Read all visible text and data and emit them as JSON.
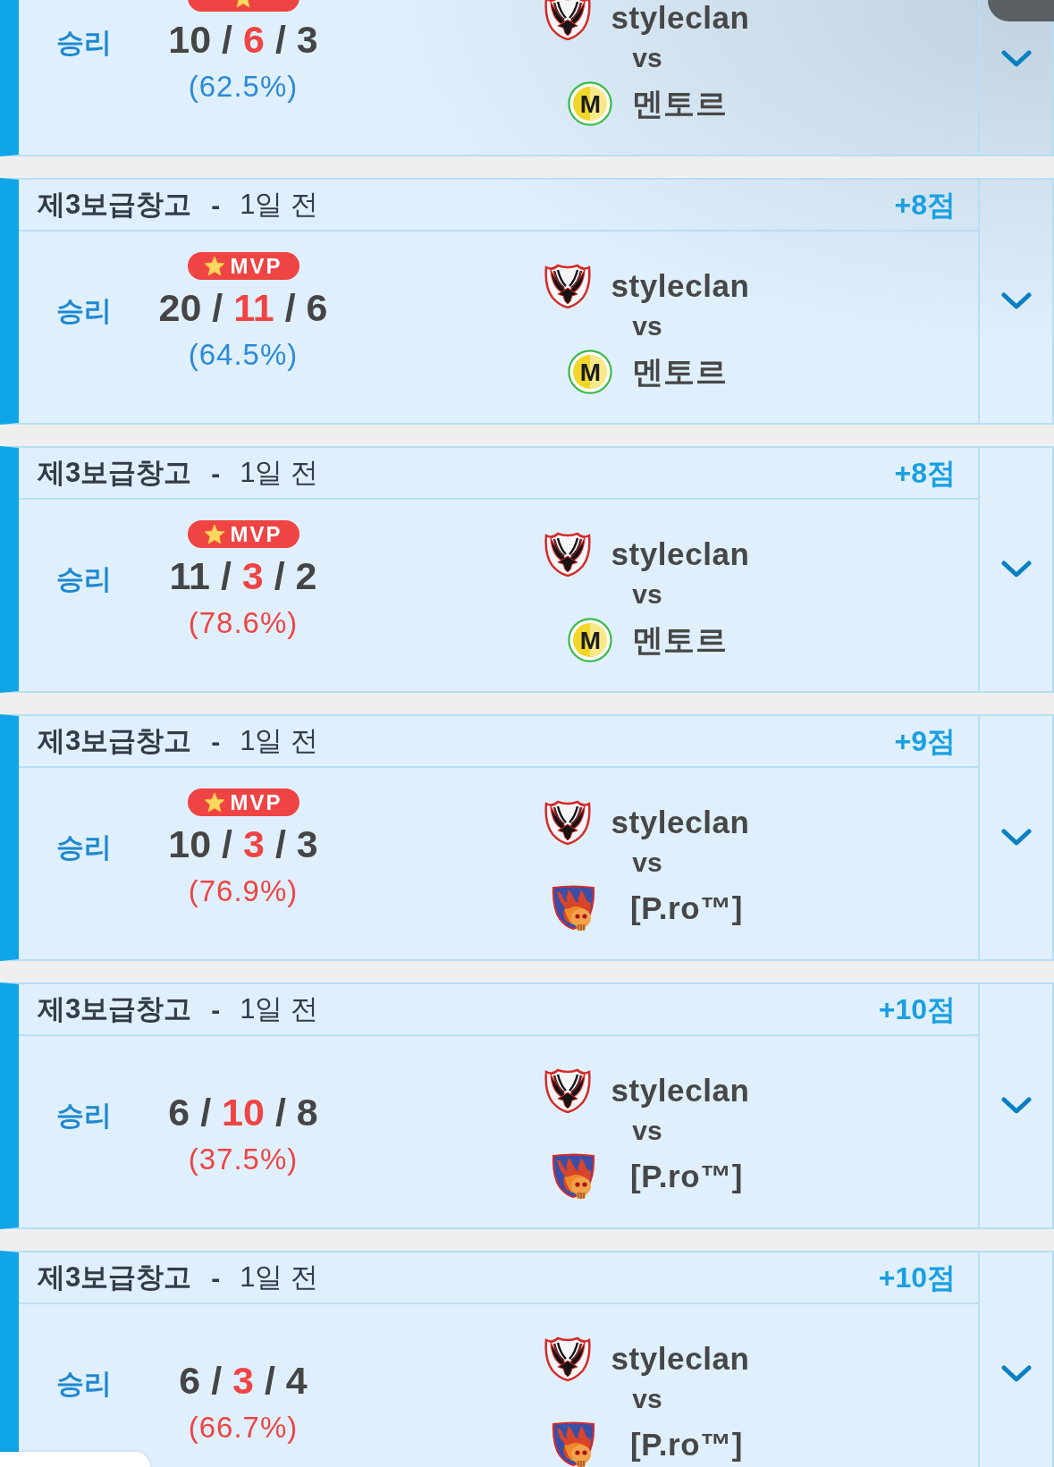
{
  "matches": [
    {
      "mvp": true,
      "result": "승리",
      "kda": [
        {
          "kind": "kills",
          "text": "10"
        },
        {
          "kind": "separator",
          "text": "/"
        },
        {
          "kind": "deaths",
          "text": "6"
        },
        {
          "kind": "separator",
          "text": "/"
        },
        {
          "kind": "assists",
          "text": "3"
        }
      ],
      "percentage": {
        "text": "(62.5%)",
        "color": "#2b8ad8"
      },
      "teams": [
        {
          "name": "styleclan",
          "logo": {
            "kind": "eagle-shield"
          }
        },
        {
          "name": "멘토르",
          "logo": {
            "kind": "m-circle",
            "text": "M"
          }
        }
      ],
      "vs": "vs",
      "expanded": false
    },
    {
      "header": {
        "map": "제3보급창고",
        "separator": "-",
        "time": "1일 전",
        "points": "+8점"
      },
      "mvp": true,
      "mvp_label": "MVP",
      "result": "승리",
      "kda": [
        {
          "kind": "kills",
          "text": "20"
        },
        {
          "kind": "separator",
          "text": "/"
        },
        {
          "kind": "deaths",
          "text": "11"
        },
        {
          "kind": "separator",
          "text": "/"
        },
        {
          "kind": "assists",
          "text": "6"
        }
      ],
      "percentage": {
        "text": "(64.5%)",
        "color": "#2b8ad8"
      },
      "teams": [
        {
          "name": "styleclan",
          "logo": {
            "kind": "eagle-shield"
          }
        },
        {
          "name": "멘토르",
          "logo": {
            "kind": "m-circle",
            "text": "M"
          }
        }
      ],
      "vs": "vs",
      "expanded": false
    },
    {
      "header": {
        "map": "제3보급창고",
        "separator": "-",
        "time": "1일 전",
        "points": "+8점"
      },
      "mvp": true,
      "mvp_label": "MVP",
      "result": "승리",
      "kda": [
        {
          "kind": "kills",
          "text": "11"
        },
        {
          "kind": "separator",
          "text": "/"
        },
        {
          "kind": "deaths",
          "text": "3"
        },
        {
          "kind": "separator",
          "text": "/"
        },
        {
          "kind": "assists",
          "text": "2"
        }
      ],
      "percentage": {
        "text": "(78.6%)",
        "color": "#ef4444"
      },
      "teams": [
        {
          "name": "styleclan",
          "logo": {
            "kind": "eagle-shield"
          }
        },
        {
          "name": "멘토르",
          "logo": {
            "kind": "m-circle",
            "text": "M"
          }
        }
      ],
      "vs": "vs",
      "expanded": false
    },
    {
      "header": {
        "map": "제3보급창고",
        "separator": "-",
        "time": "1일 전",
        "points": "+9점"
      },
      "mvp": true,
      "mvp_label": "MVP",
      "result": "승리",
      "kda": [
        {
          "kind": "kills",
          "text": "10"
        },
        {
          "kind": "separator",
          "text": "/"
        },
        {
          "kind": "deaths",
          "text": "3"
        },
        {
          "kind": "separator",
          "text": "/"
        },
        {
          "kind": "assists",
          "text": "3"
        }
      ],
      "percentage": {
        "text": "(76.9%)",
        "color": "#ef4444"
      },
      "teams": [
        {
          "name": "styleclan",
          "logo": {
            "kind": "eagle-shield"
          }
        },
        {
          "name": "[P.ro™]",
          "logo": {
            "kind": "skull-shield"
          }
        }
      ],
      "vs": "vs",
      "expanded": false
    },
    {
      "header": {
        "map": "제3보급창고",
        "separator": "-",
        "time": "1일 전",
        "points": "+10점"
      },
      "mvp": false,
      "result": "승리",
      "kda": [
        {
          "kind": "kills",
          "text": "6"
        },
        {
          "kind": "separator",
          "text": "/"
        },
        {
          "kind": "deaths",
          "text": "10"
        },
        {
          "kind": "separator",
          "text": "/"
        },
        {
          "kind": "assists",
          "text": "8"
        }
      ],
      "percentage": {
        "text": "(37.5%)",
        "color": "#ef4444"
      },
      "teams": [
        {
          "name": "styleclan",
          "logo": {
            "kind": "eagle-shield"
          }
        },
        {
          "name": "[P.ro™]",
          "logo": {
            "kind": "skull-shield"
          }
        }
      ],
      "vs": "vs",
      "expanded": false
    },
    {
      "header": {
        "map": "제3보급창고",
        "separator": "-",
        "time": "1일 전",
        "points": "+10점"
      },
      "mvp": false,
      "result": "승리",
      "kda": [
        {
          "kind": "kills",
          "text": "6"
        },
        {
          "kind": "separator",
          "text": "/"
        },
        {
          "kind": "deaths",
          "text": "3"
        },
        {
          "kind": "separator",
          "text": "/"
        },
        {
          "kind": "assists",
          "text": "4"
        }
      ],
      "percentage": {
        "text": "(66.7%)",
        "color": "#ef4444"
      },
      "teams": [
        {
          "name": "styleclan",
          "logo": {
            "kind": "eagle-shield"
          }
        },
        {
          "name": "[P.ro™]",
          "logo": {
            "kind": "skull-shield"
          }
        }
      ],
      "vs": "vs",
      "expanded": false
    }
  ]
}
